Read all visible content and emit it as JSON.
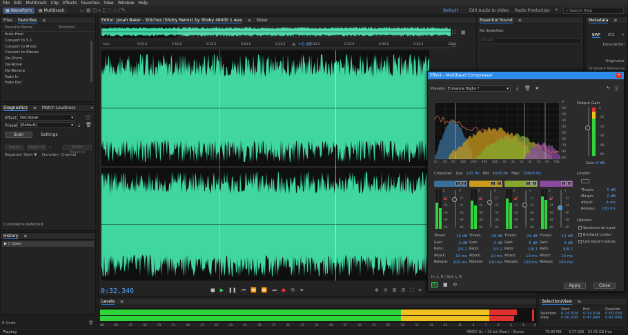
{
  "menu": [
    "File",
    "Edit",
    "Multitrack",
    "Clip",
    "Effects",
    "Favorites",
    "View",
    "Window",
    "Help"
  ],
  "modes": {
    "waveform": "Waveform",
    "multitrack": "Multitrack"
  },
  "workspaces": [
    "Default",
    "Edit Audio to Video",
    "Radio Production"
  ],
  "search_placeholder": "Search Help",
  "files_tab": "Files",
  "favorites_tab": "Favorites",
  "fav_cols": {
    "name": "Favorite Name",
    "shortcut": "Shortcut"
  },
  "favorites": [
    "Auto Heal",
    "Convert to 5.1",
    "Convert to Mono",
    "Convert to Stereo",
    "De-Drum",
    "De-Noise",
    "De-Reverb",
    "Fade In",
    "Fade Out"
  ],
  "diagnostics": {
    "tab": "Diagnostics",
    "tab2": "Match Loudness",
    "effect_label": "Effect:",
    "effect_value": "DeClipper",
    "presets_label": "Presets:",
    "presets_value": "(Default)",
    "scan": "Scan",
    "settings": "Settings",
    "repair": "Repair",
    "repair_all": "Repair All",
    "delete": "Delete Repaired",
    "cols": [
      "Repaired",
      "Start ▼",
      "Duration",
      "Channel"
    ],
    "status": "0 problems detected"
  },
  "history": {
    "tab": "History",
    "item": "Open"
  },
  "undo": "0 Undo",
  "playing": "Playing",
  "editor": {
    "tab": "Editor: Jonah Baker - Stitches (Shoby Remix) by Shoby 48000 1.wav",
    "mixer": "Mixer",
    "timecode": "0:32.346",
    "zoom": "+0 dB",
    "ruler": [
      "hms",
      "0:05.0",
      "0:10.0",
      "0:15.0",
      "0:20.0",
      "0:25.0",
      "0:30.0",
      "0:35.0",
      "0:40.0",
      "0:45.0",
      "(Clip)"
    ]
  },
  "levels": {
    "tab": "Levels",
    "ticks": [
      "dB",
      "-59",
      "-57",
      "-55",
      "-53",
      "-51",
      "-49",
      "-47",
      "-45",
      "-43",
      "-41",
      "-39",
      "-37",
      "-35",
      "-33",
      "-31",
      "-29",
      "-27",
      "-25",
      "-23",
      "-21",
      "-19",
      "-17",
      "-15",
      "-13",
      "-11",
      "-9",
      "-7",
      "-5",
      "-3",
      "-1",
      "0"
    ]
  },
  "essential": {
    "tab": "Essential Sound",
    "no_selection": "No Selection",
    "preset": "Preset"
  },
  "metadata": {
    "tab": "Metadata",
    "bwf": "BWF",
    "id3": "ID3",
    "description": "Description",
    "originator": "Originator",
    "originator_ref": "Originator Reference"
  },
  "compressor": {
    "title": "Effect - Multiband Compressor",
    "presets_label": "Presets:",
    "preset_value": "Enhance Highs *",
    "freq_ticks": [
      "Hz",
      "50",
      "60",
      "100",
      "200",
      "300",
      "400",
      "1k",
      "2k",
      "3k",
      "4k",
      "5k",
      "6k",
      "10k"
    ],
    "db_ticks": [
      "-0",
      "-10",
      "-20",
      "-30",
      "-40",
      "-50",
      "-60",
      "-70",
      "-80",
      "-90"
    ],
    "output_gain_label": "Output Gain",
    "out_ticks": [
      "0",
      "-12",
      "-24",
      "-36",
      "-48",
      "-60"
    ],
    "out_gain_value": "0 dB",
    "crossover": {
      "label": "Crossover:",
      "low": "Low",
      "low_val": "120 Hz",
      "mid": "Mid",
      "mid_val": "4500 Hz",
      "high": "High",
      "high_val": "10000 Hz"
    },
    "limiter": {
      "label": "Limiter",
      "thresh": "Thresh:",
      "thresh_val": "0 dB",
      "margin": "Margin:",
      "margin_val": "0 dB",
      "attack": "Attack:",
      "attack_val": "4 ms",
      "release": "Release:",
      "release_val": "100 ms"
    },
    "options": {
      "label": "Options",
      "spectrum": "Spectrum on Input",
      "brickwall": "Brickwall Limiter",
      "link": "Link Band Controls"
    },
    "bands": [
      {
        "color": "#3a6f9a",
        "thresh": "-15 dB",
        "gain": "-2 dB",
        "ratio": "2/5.1",
        "attack": "10 ms",
        "release": "100 ms"
      },
      {
        "color": "#c89a1a",
        "thresh": "-29 dB",
        "gain": "-2 dB",
        "ratio": "2/5.1",
        "attack": "10 ms",
        "release": "100 ms"
      },
      {
        "color": "#86a82e",
        "thresh": "-24 dB",
        "gain": "5 dB",
        "ratio": "1/8.1",
        "attack": "10 ms",
        "release": "100 ms"
      },
      {
        "color": "#8a4aa0",
        "thresh": "-11 dB",
        "gain": "5 dB",
        "ratio": "5/8.1",
        "attack": "10 ms",
        "release": "100 ms"
      }
    ],
    "band_labels": [
      "Thresh:",
      "Gain:",
      "Ratio:",
      "Attack:",
      "Release:"
    ],
    "meter_ticks": [
      "0",
      "-12",
      "-24",
      "-36",
      "-48",
      "-60"
    ],
    "routing": "In: L, R | Out: L, R",
    "apply": "Apply",
    "close": "Close"
  },
  "selection_view": {
    "tab": "Selection/View",
    "cols": [
      "Start",
      "End",
      "Duration"
    ],
    "selection": {
      "label": "Selection",
      "start": "0:14.504",
      "end": "0:14.504",
      "duration": "0:00.000"
    },
    "view": {
      "label": "View",
      "start": "0:00.000",
      "end": "0:47.645",
      "duration": "0:47.645"
    }
  },
  "statusbar": {
    "format": "48000 Hz • 32-bit (float) • Stereo",
    "size": "79.80 MB",
    "duration": "3:37.933",
    "free": "53.56 GB free"
  },
  "colors": {
    "wave": "#3fd6a0",
    "accent": "#2d8ceb",
    "meter_green": "#2fd33a",
    "meter_yellow": "#f0c020",
    "meter_red": "#e03030"
  }
}
